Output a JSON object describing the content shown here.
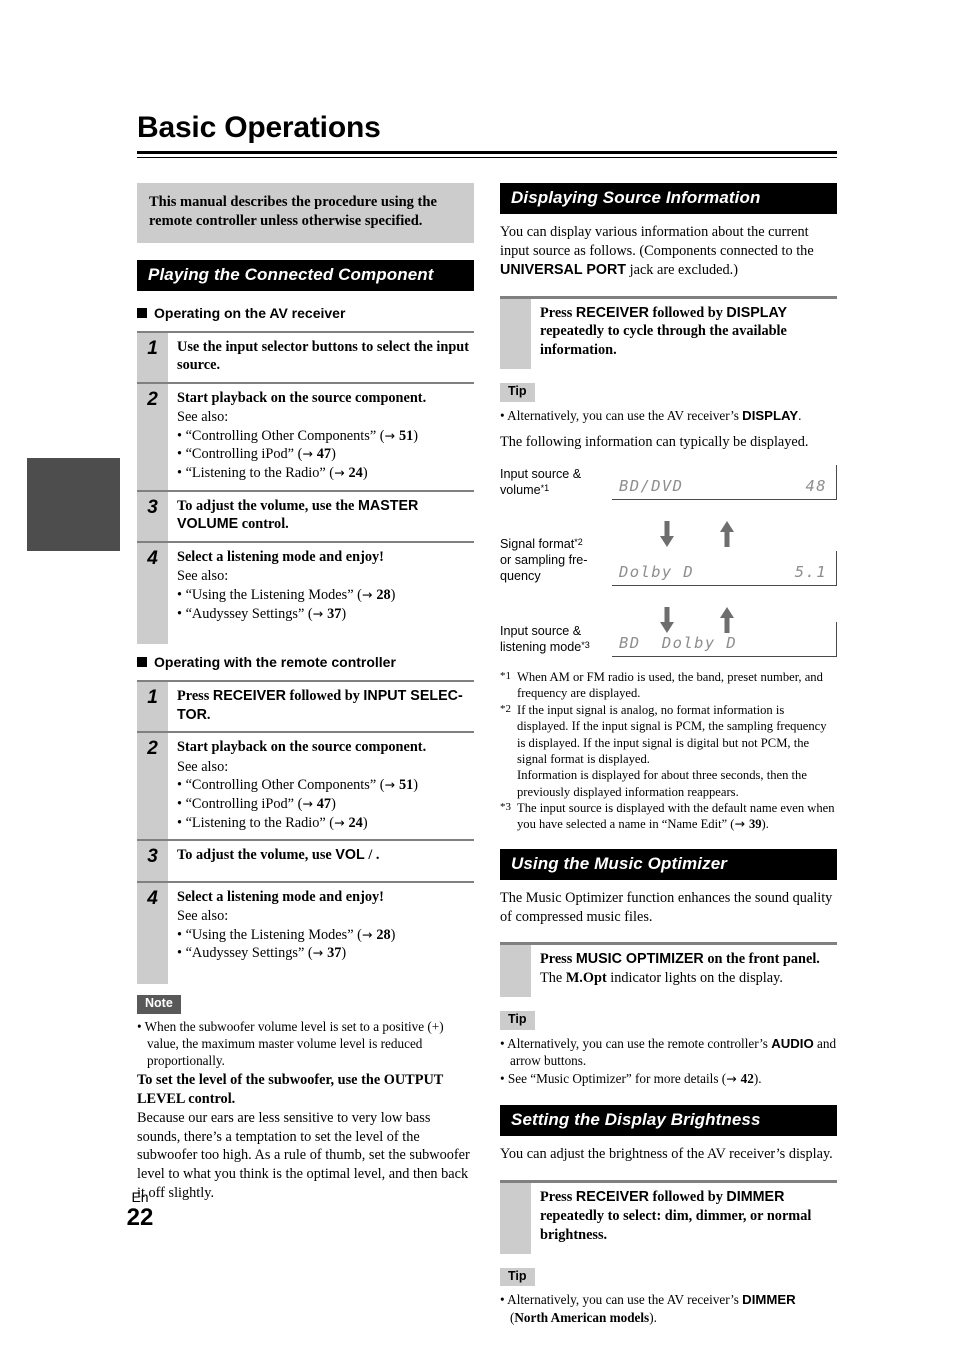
{
  "page": {
    "title": "Basic Operations",
    "footer_lang": "En",
    "footer_number": "22"
  },
  "colors": {
    "section_bar_bg": "#000000",
    "section_bar_text": "#ffffff",
    "notice_bg": "#cccccc",
    "note_label_bg": "#595959",
    "tip_label_bg": "#cccccc",
    "chapter_tab": "#4d4d4d",
    "lcd_text": "#8e8e8e",
    "rule_gray": "#808080"
  },
  "left_column": {
    "notice": "This manual describes the procedure using the remote controller unless otherwise specified.",
    "section_title": "Playing the Connected Component",
    "subsection_a": {
      "heading": "Operating on the AV receiver",
      "steps": [
        {
          "num": "1",
          "lead": "Use the input selector buttons to select the input source."
        },
        {
          "num": "2",
          "lead": "Start playback on the source component.",
          "see_also": "See also:",
          "bullets": [
            {
              "text": "• “Controlling Other Components” (",
              "page": "51",
              "tail": ")"
            },
            {
              "text": "• “Controlling iPod” (",
              "page": "47",
              "tail": ")"
            },
            {
              "text": "• “Listening to the Radio” (",
              "page": "24",
              "tail": ")"
            }
          ]
        },
        {
          "num": "3",
          "lead_pre": "To adjust the volume, use the ",
          "lead_kbd": "MASTER VOLUME",
          "lead_post": " control."
        },
        {
          "num": "4",
          "lead": "Select a listening mode and enjoy!",
          "see_also": "See also:",
          "bullets": [
            {
              "text": "• “Using the Listening Modes” (",
              "page": "28",
              "tail": ")"
            },
            {
              "text": "• “Audyssey Settings” (",
              "page": "37",
              "tail": ")"
            }
          ]
        }
      ]
    },
    "subsection_b": {
      "heading": "Operating with the remote controller",
      "steps": [
        {
          "num": "1",
          "lead_pre": "Press ",
          "lead_kbd": "RECEIVER",
          "lead_mid": " followed by ",
          "lead_kbd2": "INPUT SELEC-TOR",
          "lead_post": "."
        },
        {
          "num": "2",
          "lead": "Start playback on the source component.",
          "see_also": "See also:",
          "bullets": [
            {
              "text": "• “Controlling Other Components” (",
              "page": "51",
              "tail": ")"
            },
            {
              "text": "• “Controlling iPod” (",
              "page": "47",
              "tail": ")"
            },
            {
              "text": "• “Listening to the Radio” (",
              "page": "24",
              "tail": ")"
            }
          ]
        },
        {
          "num": "3",
          "lead_pre": "To adjust the volume, use ",
          "lead_kbd": "VOL",
          "lead_post": "   /   ."
        },
        {
          "num": "4",
          "lead": "Select a listening mode and enjoy!",
          "see_also": "See also:",
          "bullets": [
            {
              "text": "• “Using the Listening Modes” (",
              "page": "28",
              "tail": ")"
            },
            {
              "text": "• “Audyssey Settings” (",
              "page": "37",
              "tail": ")"
            }
          ]
        }
      ]
    },
    "note": {
      "label": "Note",
      "bullet": "• When the subwoofer volume level is set to a positive (+) value, the maximum master volume level is reduced proportionally.",
      "bold_line": "To set the level of the subwoofer, use the OUTPUT LEVEL control.",
      "body": "Because our ears are less sensitive to very low bass sounds, there’s a temptation to set the level of the subwoofer too high. As a rule of thumb, set the subwoofer level to what you think is the optimal level, and then back it off slightly."
    }
  },
  "right_column": {
    "display_info": {
      "section_title": "Displaying Source Information",
      "intro_pre": "You can display various information about the current input source as follows. (Components connected to the ",
      "intro_kbd": "UNIVERSAL PORT",
      "intro_post": " jack are excluded.)",
      "instruction": {
        "pre": "Press ",
        "kbd1": "RECEIVER",
        "mid": " followed by ",
        "kbd2": "DISPLAY",
        "post": " repeatedly to cycle through the available information."
      },
      "tip": {
        "label": "Tip",
        "items": [
          {
            "pre": "• Alternatively, you can use the AV receiver’s ",
            "kbd": "DISPLAY",
            "post": "."
          }
        ]
      },
      "following_text": "The following information can typically be displayed.",
      "flow": [
        {
          "label_line1": "Input source &",
          "label_line2": "volume",
          "footnote_mark": "*1",
          "lcd_left": "BD/DVD",
          "lcd_right": "48"
        },
        {
          "label_line1": "Signal format",
          "footnote_mark": "*2",
          "label_line2": "or sampling fre-",
          "label_line3": "quency",
          "lcd_left": "Dolby D",
          "lcd_right": "5.1"
        },
        {
          "label_line1": "Input source &",
          "label_line2": "listening mode",
          "footnote_mark": "*3",
          "lcd_left": "BD  Dolby D",
          "lcd_right": ""
        }
      ],
      "footnotes": [
        {
          "mark": "*1",
          "paragraphs": [
            "When AM or FM radio is used, the band, preset number, and frequency are displayed."
          ]
        },
        {
          "mark": "*2",
          "paragraphs": [
            "If the input signal is analog, no format information is displayed. If the input signal is PCM, the sampling frequency is displayed. If the input signal is digital but not PCM, the signal format is displayed.",
            "Information is displayed for about three seconds, then the previously displayed information reappears."
          ]
        },
        {
          "mark": "*3",
          "paragraphs_rich": {
            "pre": "The input source is displayed with the default name even when you have selected a name in “Name Edit” (",
            "page": "39",
            "post": ")."
          }
        }
      ]
    },
    "music_optimizer": {
      "section_title": "Using the Music Optimizer",
      "intro": "The Music Optimizer function enhances the sound quality of compressed music files.",
      "instruction": {
        "pre": "Press ",
        "kbd1": "MUSIC OPTIMIZER",
        "post": " on the front panel.",
        "sub_pre": "The ",
        "sub_kbd": "M.Opt",
        "sub_post": " indicator lights on the display."
      },
      "tip": {
        "label": "Tip",
        "items": [
          {
            "pre": "• Alternatively, you can use the remote controller’s ",
            "kbd": "AUDIO",
            "post": " and arrow buttons."
          },
          {
            "pre": "• See “Music Optimizer” for more details (",
            "page": "42",
            "post": ")."
          }
        ]
      }
    },
    "display_brightness": {
      "section_title": "Setting the Display Brightness",
      "intro": "You can adjust the brightness of the AV receiver’s display.",
      "instruction": {
        "pre": "Press ",
        "kbd1": "RECEIVER",
        "mid": " followed by ",
        "kbd2": "DIMMER",
        "post": " repeatedly to select: dim, dimmer, or normal brightness."
      },
      "tip": {
        "label": "Tip",
        "items": [
          {
            "pre": "• Alternatively, you can use the AV receiver’s ",
            "kbd": "DIMMER",
            "post": " (",
            "bold_tail": "North American models",
            "post2": ")."
          }
        ]
      }
    }
  }
}
